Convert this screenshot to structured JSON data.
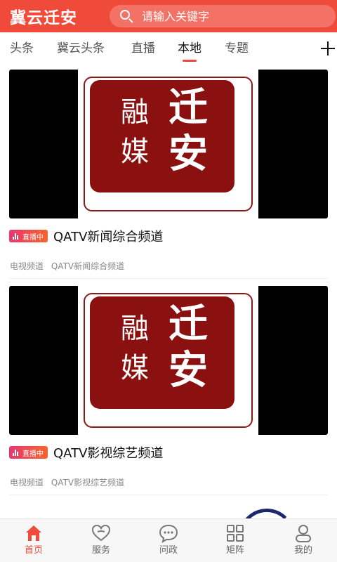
{
  "header": {
    "app_title": "冀云迁安",
    "search_placeholder": "请输入关键字",
    "background_color": "#f04b3a"
  },
  "tabs": {
    "items": [
      {
        "label": "头条"
      },
      {
        "label": "冀云头条"
      },
      {
        "label": "直播"
      },
      {
        "label": "本地",
        "active": true
      },
      {
        "label": "专题"
      }
    ],
    "add_icon": "plus-icon"
  },
  "feed": {
    "items": [
      {
        "logo_text": {
          "small_top": "融",
          "small_bottom": "媒",
          "big_top": "迁",
          "big_bottom": "安"
        },
        "live_badge": "直播中",
        "title": "QATV新闻综合频道",
        "meta": {
          "category": "电视频道",
          "source": "QATV新闻综合频道"
        }
      },
      {
        "logo_text": {
          "small_top": "融",
          "small_bottom": "媒",
          "big_top": "迁",
          "big_bottom": "安"
        },
        "live_badge": "直播中",
        "title": "QATV影视综艺频道",
        "meta": {
          "category": "电视频道",
          "source": "QATV影视综艺频道"
        }
      }
    ]
  },
  "bottom_nav": {
    "items": [
      {
        "label": "首页",
        "icon": "home-icon",
        "active": true
      },
      {
        "label": "服务",
        "icon": "heart-icon"
      },
      {
        "label": "问政",
        "icon": "chat-bubble-icon"
      },
      {
        "label": "矩阵",
        "icon": "grid-icon"
      },
      {
        "label": "我的",
        "icon": "user-icon"
      }
    ],
    "active_color": "#f04b3a"
  }
}
